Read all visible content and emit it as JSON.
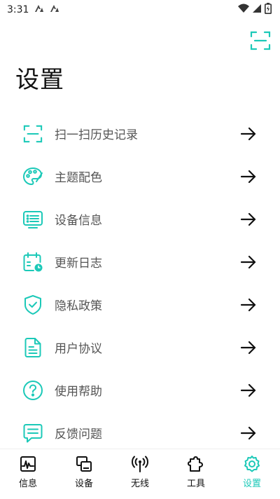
{
  "status_bar": {
    "time": "3:31"
  },
  "page": {
    "title": "设置"
  },
  "menu": {
    "items": [
      {
        "label": "扫一扫历史记录"
      },
      {
        "label": "主题配色"
      },
      {
        "label": "设备信息"
      },
      {
        "label": "更新日志"
      },
      {
        "label": "隐私政策"
      },
      {
        "label": "用户协议"
      },
      {
        "label": "使用帮助"
      },
      {
        "label": "反馈问题"
      }
    ]
  },
  "tabs": [
    {
      "label": "信息"
    },
    {
      "label": "设备"
    },
    {
      "label": "无线"
    },
    {
      "label": "工具"
    },
    {
      "label": "设置"
    }
  ],
  "colors": {
    "accent": "#1cc9b8",
    "text_primary": "#111111",
    "text_secondary": "#555555"
  }
}
